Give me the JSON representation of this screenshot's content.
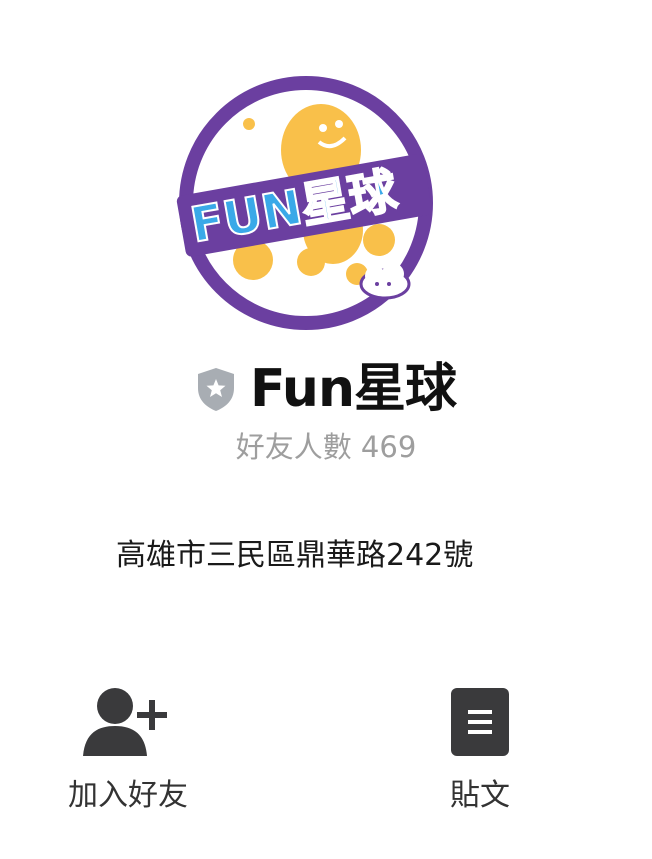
{
  "profile": {
    "logo_text": "FUN星球",
    "name": "Fun星球",
    "friend_count": "好友人數 469",
    "address": "高雄市三民區鼎華路242號",
    "badge_icon": "shield-star-icon"
  },
  "actions": [
    {
      "label": "加入好友",
      "icon": "add-friend-icon"
    },
    {
      "label": "貼文",
      "icon": "posts-icon"
    }
  ],
  "colors": {
    "logo_ring": "#6b3fa0",
    "logo_blob": "#f9c04a",
    "logo_banner": "#6b3fa0",
    "logo_fun_text": "#3aa9e8",
    "badge": "#a8adb3",
    "icon_dark": "#3a3a3c"
  }
}
